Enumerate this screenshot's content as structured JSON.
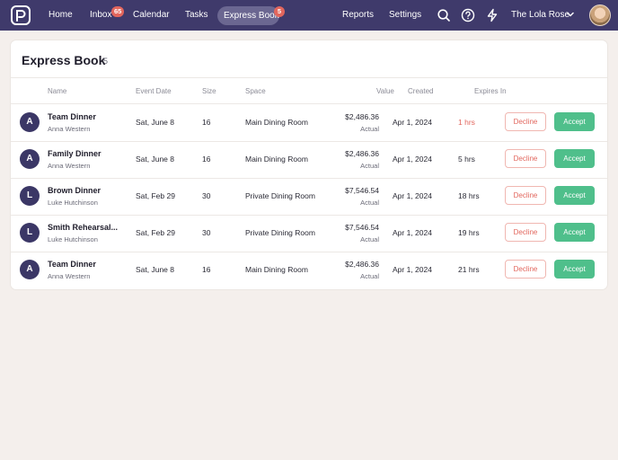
{
  "nav": {
    "home": "Home",
    "inbox": "Inbox",
    "inbox_badge": "65",
    "calendar": "Calendar",
    "tasks": "Tasks",
    "express_book": "Express Book",
    "express_badge": "5",
    "reports": "Reports",
    "settings": "Settings",
    "venue": "The Lola Rose",
    "colors": {
      "bar": "#3f3a6b",
      "active_pill": "#6b6791",
      "badge": "#e2665d"
    }
  },
  "page": {
    "title": "Express Book",
    "count": "5"
  },
  "columns": {
    "name": "Name",
    "event_date": "Event Date",
    "size": "Size",
    "space": "Space",
    "value": "Value",
    "created": "Created",
    "expires_in": "Expires In"
  },
  "rows": [
    {
      "initial": "A",
      "name": "Team Dinner",
      "owner": "Anna Western",
      "date": "Sat, June 8",
      "size": "16",
      "space": "Main Dining Room",
      "value": "$2,486.36",
      "value_type": "Actual",
      "created": "Apr 1, 2024",
      "expires": "1 hrs",
      "decline": "Decline",
      "accept": "Accept"
    },
    {
      "initial": "A",
      "name": "Family Dinner",
      "owner": "Anna Western",
      "date": "Sat, June 8",
      "size": "16",
      "space": "Main Dining Room",
      "value": "$2,486.36",
      "value_type": "Actual",
      "created": "Apr 1, 2024",
      "expires": "5 hrs",
      "decline": "Decline",
      "accept": "Accept"
    },
    {
      "initial": "L",
      "name": "Brown Dinner",
      "owner": "Luke Hutchinson",
      "date": "Sat, Feb 29",
      "size": "30",
      "space": "Private Dining Room",
      "value": "$7,546.54",
      "value_type": "Actual",
      "created": "Apr 1, 2024",
      "expires": "18 hrs",
      "decline": "Decline",
      "accept": "Accept"
    },
    {
      "initial": "L",
      "name": "Smith Rehearsal...",
      "owner": "Luke Hutchinson",
      "date": "Sat, Feb 29",
      "size": "30",
      "space": "Private Dining Room",
      "value": "$7,546.54",
      "value_type": "Actual",
      "created": "Apr 1, 2024",
      "expires": "19 hrs",
      "decline": "Decline",
      "accept": "Accept"
    },
    {
      "initial": "A",
      "name": "Team Dinner",
      "owner": "Anna Western",
      "date": "Sat, June 8",
      "size": "16",
      "space": "Main Dining Room",
      "value": "$2,486.36",
      "value_type": "Actual",
      "created": "Apr 1, 2024",
      "expires": "21 hrs",
      "decline": "Decline",
      "accept": "Accept"
    }
  ],
  "colors": {
    "accept": "#4fbf8b",
    "decline": "#e2665d",
    "avatar": "#3b3766",
    "urgent": "#e2665d"
  },
  "icons": [
    "logo-icon",
    "search-icon",
    "help-icon",
    "lightning-icon",
    "chevron-down-icon"
  ]
}
